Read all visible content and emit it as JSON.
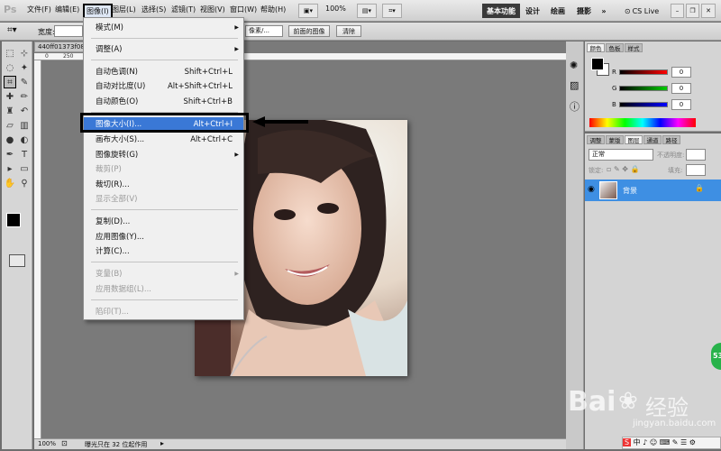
{
  "app": {
    "logo": "Ps"
  },
  "menubar": {
    "items": [
      "文件(F)",
      "编辑(E)",
      "图像(I)",
      "图层(L)",
      "选择(S)",
      "滤镜(T)",
      "视图(V)",
      "窗口(W)",
      "帮助(H)"
    ],
    "zoom": "100%",
    "workspaces": [
      "基本功能",
      "设计",
      "绘画",
      "摄影"
    ],
    "more": "»",
    "cslive": "CS Live"
  },
  "options": {
    "width_label": "宽度:",
    "units_field": "像素/...",
    "front_image_btn": "前面的图像",
    "clear_btn": "清除"
  },
  "document": {
    "tab_title": "440ff01373f08",
    "ruler_labels": [
      "0",
      "250"
    ]
  },
  "status": {
    "zoom": "100%",
    "info": "曝光只在 32 位起作用"
  },
  "image_menu": {
    "items": [
      {
        "label": "模式(M)",
        "shortcut": "",
        "submenu": true,
        "disabled": false
      },
      {
        "label": "调整(A)",
        "shortcut": "",
        "submenu": true,
        "disabled": false
      },
      {
        "label": "自动色调(N)",
        "shortcut": "Shift+Ctrl+L",
        "submenu": false,
        "disabled": false
      },
      {
        "label": "自动对比度(U)",
        "shortcut": "Alt+Shift+Ctrl+L",
        "submenu": false,
        "disabled": false
      },
      {
        "label": "自动颜色(O)",
        "shortcut": "Shift+Ctrl+B",
        "submenu": false,
        "disabled": false
      },
      {
        "label": "图像大小(I)...",
        "shortcut": "Alt+Ctrl+I",
        "submenu": false,
        "disabled": false,
        "highlighted": true
      },
      {
        "label": "画布大小(S)...",
        "shortcut": "Alt+Ctrl+C",
        "submenu": false,
        "disabled": false
      },
      {
        "label": "图像旋转(G)",
        "shortcut": "",
        "submenu": true,
        "disabled": false
      },
      {
        "label": "裁剪(P)",
        "shortcut": "",
        "submenu": false,
        "disabled": true
      },
      {
        "label": "裁切(R)...",
        "shortcut": "",
        "submenu": false,
        "disabled": false
      },
      {
        "label": "显示全部(V)",
        "shortcut": "",
        "submenu": false,
        "disabled": true
      },
      {
        "label": "复制(D)...",
        "shortcut": "",
        "submenu": false,
        "disabled": false
      },
      {
        "label": "应用图像(Y)...",
        "shortcut": "",
        "submenu": false,
        "disabled": false
      },
      {
        "label": "计算(C)...",
        "shortcut": "",
        "submenu": false,
        "disabled": false
      },
      {
        "label": "变量(B)",
        "shortcut": "",
        "submenu": true,
        "disabled": true
      },
      {
        "label": "应用数据组(L)...",
        "shortcut": "",
        "submenu": false,
        "disabled": true
      },
      {
        "label": "陷印(T)...",
        "shortcut": "",
        "submenu": false,
        "disabled": true
      }
    ]
  },
  "color_panel": {
    "tabs": [
      "颜色",
      "色板",
      "样式"
    ],
    "channels": [
      {
        "name": "R",
        "value": "0"
      },
      {
        "name": "G",
        "value": "0"
      },
      {
        "name": "B",
        "value": "0"
      }
    ]
  },
  "layers_panel": {
    "tabs": [
      "调整",
      "蒙版",
      "图层",
      "通道",
      "路径"
    ],
    "blend_mode": "正常",
    "opacity_label": "不透明度:",
    "lock_label": "锁定:",
    "fill_label": "填充:",
    "layer": {
      "name": "背景"
    }
  },
  "watermark": {
    "brand": "Bai",
    "brand_suffix": "经验",
    "url": "jingyan.baidu.com"
  },
  "side_badge": "53",
  "colors": {
    "highlight": "#3a78d6",
    "annotation": "#000000",
    "layer_selected": "#3e8fe3"
  }
}
